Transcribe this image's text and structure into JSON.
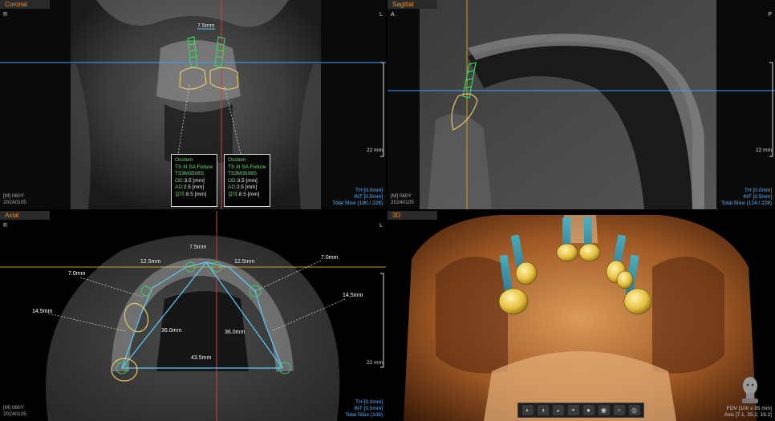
{
  "coronal": {
    "tab": "Coronal",
    "orient_left": "R",
    "orient_right": "L",
    "scale": "22 mm",
    "meas_top": "7.5mm",
    "meta_left": [
      "[M] 060Y",
      "20240105"
    ],
    "meta_right": [
      "TH [0.0mm]",
      "INT [0.5mm]",
      "Total Slice (180 / 228)"
    ],
    "implants": [
      {
        "brand": "Osstem",
        "model": "TS III SA Fixture",
        "code": "TS3M3508S",
        "od_label": "OD:",
        "od": "3.5 [mm]",
        "ad_label": "AD:",
        "ad": "2.5 [mm]",
        "len_label": "길이:",
        "len": "8.5 [mm]"
      },
      {
        "brand": "Osstem",
        "model": "TS III SA Fixture",
        "code": "TS3M3508S",
        "od_label": "OD:",
        "od": "3.5 [mm]",
        "ad_label": "AD:",
        "ad": "2.5 [mm]",
        "len_label": "길이:",
        "len": "8.5 [mm]"
      }
    ]
  },
  "sagittal": {
    "tab": "Sagittal",
    "orient_left": "A",
    "orient_right": "P",
    "scale": "22 mm",
    "meta_left": [
      "[M] 060Y",
      "20240105"
    ],
    "meta_right": [
      "TH [0.0mm]",
      "INT [0.5mm]",
      "Total Slice (124 / 228)"
    ]
  },
  "axial": {
    "tab": "Axial",
    "orient_left": "R",
    "orient_right": "L",
    "scale": "22 mm",
    "meta_left": [
      "[M] 060Y",
      "20240105"
    ],
    "meta_right": [
      "TH [0.0mm]",
      "INT [0.5mm]",
      "Total Slice (108)"
    ],
    "measurements": {
      "top": "7.5mm",
      "left_125": "12.5mm",
      "right_125": "12.5mm",
      "left_70": "7.0mm",
      "right_70": "7.0mm",
      "left_145": "14.5mm",
      "right_145": "14.5mm",
      "left_360": "36.0mm",
      "right_360": "36.0mm",
      "bottom": "43.5mm"
    }
  },
  "three_d": {
    "tab": "3D",
    "fov": "FOV [100 x 85 mm]",
    "axis": "Axis [7.1, 35.2, 19.2]",
    "toolbar_count": 8
  },
  "colors": {
    "tab_text": "#e09030",
    "implant_green": "#3ecf6a",
    "crown_yellow": "#e6c96a",
    "measure_cyan": "#5ad0ff",
    "crosshair_blue": "#3fa0ff",
    "crosshair_red": "#d04040",
    "crosshair_yellow": "#c8a020"
  }
}
